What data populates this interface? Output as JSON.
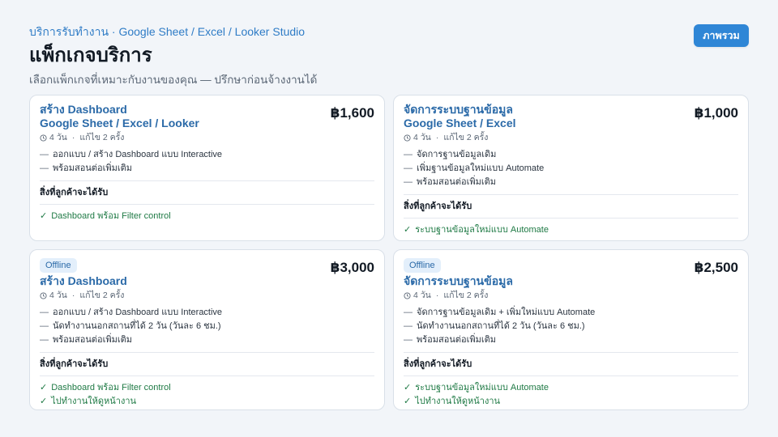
{
  "header": {
    "kicker": "บริการรับทำงาน · Google Sheet / Excel / Looker Studio",
    "title": "แพ็กเกจบริการ",
    "subtitle": "เลือกแพ็กเกจที่เหมาะกับงานของคุณ — ปรึกษาก่อนจ้างงานได้",
    "overview_button": "ภาพรวม"
  },
  "deliver_label": "สิ่งที่ลูกค้าจะได้รับ",
  "cards": [
    {
      "badge": "",
      "title_line1": "สร้าง Dashboard",
      "title_line2": "Google Sheet / Excel / Looker",
      "price": "฿1,600",
      "duration": "4 วัน",
      "revisions": "แก้ไข 2 ครั้ง",
      "features": [
        "ออกแบบ / สร้าง Dashboard แบบ Interactive",
        "พร้อมสอนต่อเพิ่มเติม"
      ],
      "deliverables": [
        "Dashboard พร้อม Filter control"
      ]
    },
    {
      "badge": "",
      "title_line1": "จัดการระบบฐานข้อมูล",
      "title_line2": "Google Sheet / Excel",
      "price": "฿1,000",
      "duration": "4 วัน",
      "revisions": "แก้ไข 2 ครั้ง",
      "features": [
        "จัดการฐานข้อมูลเดิม",
        "เพิ่มฐานข้อมูลใหม่แบบ Automate",
        "พร้อมสอนต่อเพิ่มเติม"
      ],
      "deliverables": [
        "ระบบฐานข้อมูลใหม่แบบ Automate"
      ]
    },
    {
      "badge": "Offline",
      "title_line1": "สร้าง Dashboard",
      "title_line2": "",
      "price": "฿3,000",
      "duration": "4 วัน",
      "revisions": "แก้ไข 2 ครั้ง",
      "features": [
        "ออกแบบ / สร้าง Dashboard แบบ Interactive",
        "นัดทำงานนอกสถานที่ได้ 2 วัน (วันละ 6 ชม.)",
        "พร้อมสอนต่อเพิ่มเติม"
      ],
      "deliverables": [
        "Dashboard พร้อม Filter control",
        "ไปทำงานให้ดูหน้างาน"
      ]
    },
    {
      "badge": "Offline",
      "title_line1": "จัดการระบบฐานข้อมูล",
      "title_line2": "",
      "price": "฿2,500",
      "duration": "4 วัน",
      "revisions": "แก้ไข 2 ครั้ง",
      "features": [
        "จัดการฐานข้อมูลเดิม + เพิ่มใหม่แบบ Automate",
        "นัดทำงานนอกสถานที่ได้ 2 วัน (วันละ 6 ชม.)",
        "พร้อมสอนต่อเพิ่มเติม"
      ],
      "deliverables": [
        "ระบบฐานข้อมูลใหม่แบบ Automate",
        "ไปทำงานให้ดูหน้างาน"
      ]
    }
  ]
}
